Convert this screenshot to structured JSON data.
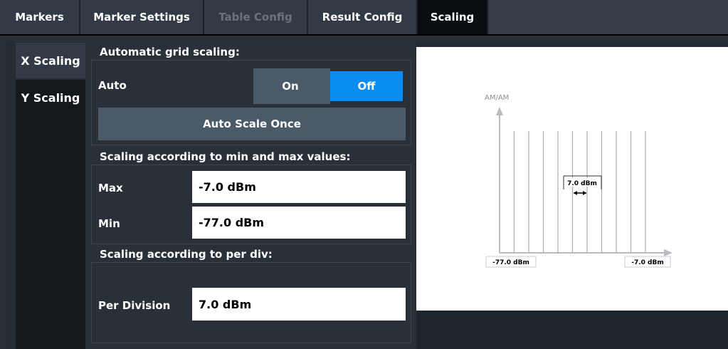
{
  "tabs": [
    {
      "label": "Markers",
      "state": "normal"
    },
    {
      "label": "Marker Settings",
      "state": "normal"
    },
    {
      "label": "Table Config",
      "state": "disabled"
    },
    {
      "label": "Result Config",
      "state": "normal"
    },
    {
      "label": "Scaling",
      "state": "active"
    }
  ],
  "side_tabs": [
    {
      "label": "X Scaling",
      "active": true
    },
    {
      "label": "Y Scaling",
      "active": false
    }
  ],
  "auto_group": {
    "title": "Automatic grid scaling:",
    "auto_label": "Auto",
    "on_label": "On",
    "off_label": "Off",
    "selected": "Off",
    "auto_scale_once_label": "Auto Scale Once"
  },
  "minmax_group": {
    "title": "Scaling according to min and max values:",
    "max_label": "Max",
    "max_value": "-7.0 dBm",
    "min_label": "Min",
    "min_value": "-77.0 dBm"
  },
  "perdiv_group": {
    "title": "Scaling according to per div:",
    "per_division_label": "Per Division",
    "per_division_value": "7.0 dBm"
  },
  "diagram": {
    "y_axis_label": "AM/AM",
    "min_label": "-77.0 dBm",
    "max_label": "-7.0 dBm",
    "per_div_label": "7.0 dBm"
  },
  "colors": {
    "accent": "#0a8cf0",
    "panel": "#2a3038",
    "button": "#4a5a68"
  }
}
